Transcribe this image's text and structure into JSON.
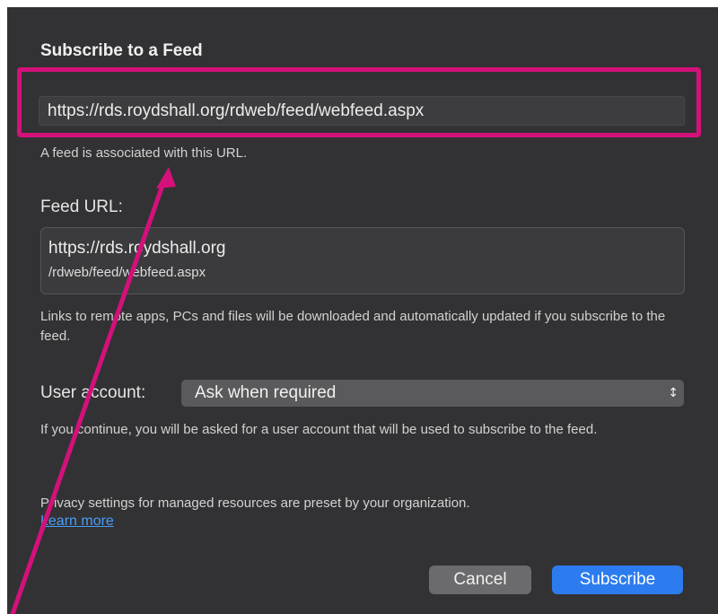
{
  "dialog": {
    "title": "Subscribe to a Feed",
    "url_input_value": "https://rds.roydshall.org/rdweb/feed/webfeed.aspx",
    "url_hint": "A feed is associated with this URL.",
    "feed_url_label": "Feed URL:",
    "feed_url_line1": "https://rds.roydshall.org",
    "feed_url_line2": "/rdweb/feed/webfeed.aspx",
    "feed_description": "Links to remote apps, PCs and files will be downloaded and automatically updated if you subscribe to the feed.",
    "user_account_label": "User account:",
    "user_account_value": "Ask when required",
    "user_account_hint": "If you continue, you will be asked for a user account that will be used to subscribe to the feed.",
    "privacy_text": "Privacy settings for managed resources are preset by your organization.",
    "learn_more": "Learn more",
    "cancel_label": "Cancel",
    "subscribe_label": "Subscribe"
  },
  "colors": {
    "dialog_background": "#323234",
    "highlight_annotation": "#d4117a",
    "primary_button": "#2c7cf0",
    "link": "#4a9cf5"
  },
  "icons": {
    "select_arrows": "updown-chevron-icon",
    "annotation": "annotation-arrow"
  }
}
